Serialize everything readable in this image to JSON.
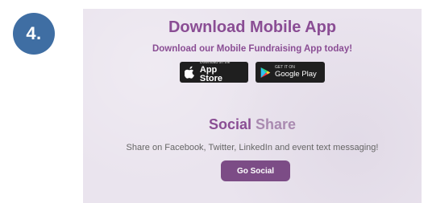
{
  "step": {
    "number": "4."
  },
  "download": {
    "title": "Download Mobile App",
    "subtitle": "Download our Mobile Fundraising App today!",
    "app_store": {
      "small": "Download on the",
      "big": "App Store",
      "icon": "apple-icon"
    },
    "google_play": {
      "small": "GET IT ON",
      "big": "Google Play",
      "icon": "google-play-icon"
    }
  },
  "social": {
    "title_a": "Social ",
    "title_b": "Share",
    "subtitle": "Share on Facebook, Twitter, LinkedIn and event text messaging!",
    "button": "Go Social"
  },
  "colors": {
    "accent": "#8a4d94",
    "badge": "#3f6ea3",
    "button": "#7c4c86",
    "panel": "#eae4ee"
  }
}
